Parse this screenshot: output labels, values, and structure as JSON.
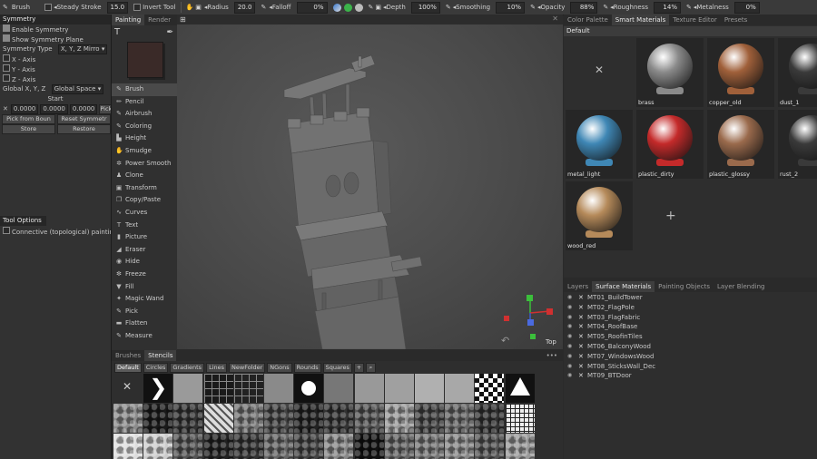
{
  "toolbar": {
    "brush_label": "Brush",
    "brush_size": "15.0",
    "steady_stroke": "Steady Stroke",
    "invert_tool": "Invert Tool",
    "radius_label": "Radius",
    "radius_value": "20.0",
    "falloff_label": "Falloff",
    "falloff_value": "0%",
    "depth_label": "Depth",
    "depth_value": "100%",
    "smoothing_label": "Smoothing",
    "smoothing_value": "10%",
    "opacity_label": "Opacity",
    "opacity_value": "88%",
    "roughness_label": "Roughness",
    "roughness_value": "14%",
    "metalness_label": "Metalness",
    "metalness_value": "0%"
  },
  "symmetry": {
    "title": "Symmetry",
    "enable": "Enable Symmetry",
    "show_plane": "Show Symmetry Plane",
    "type_label": "Symmetry Type",
    "type_value": "X, Y, Z Mirro",
    "x_axis": "X - Axis",
    "y_axis": "Y - Axis",
    "z_axis": "Z - Axis",
    "global_label": "Global X, Y, Z",
    "global_value": "Global Space",
    "start_label": "Start",
    "coord_x": "0.0000",
    "coord_y": "0.0000",
    "coord_z": "0.0000",
    "pick_btn": "Pick",
    "pick_from_bounds": "Pick from Boun",
    "reset_symmetry": "Reset Symmetr",
    "store": "Store",
    "restore": "Restore"
  },
  "tool_options": {
    "title": "Tool Options",
    "connective": "Connective (topological) paintin"
  },
  "tools_tabs": {
    "painting": "Painting",
    "render": "Render"
  },
  "tools": [
    {
      "icon": "brush-icon",
      "glyph": "✎",
      "label": "Brush"
    },
    {
      "icon": "pencil-icon",
      "glyph": "✏",
      "label": "Pencil"
    },
    {
      "icon": "airbrush-icon",
      "glyph": "✎",
      "label": "Airbrush"
    },
    {
      "icon": "coloring-icon",
      "glyph": "✎",
      "label": "Coloring"
    },
    {
      "icon": "height-icon",
      "glyph": "▙",
      "label": "Height"
    },
    {
      "icon": "smudge-icon",
      "glyph": "✋",
      "label": "Smudge"
    },
    {
      "icon": "power-smooth-icon",
      "glyph": "✲",
      "label": "Power Smooth"
    },
    {
      "icon": "clone-icon",
      "glyph": "♟",
      "label": "Clone"
    },
    {
      "icon": "transform-icon",
      "glyph": "▣",
      "label": "Transform"
    },
    {
      "icon": "copy-paste-icon",
      "glyph": "❐",
      "label": "Copy/Paste"
    },
    {
      "icon": "curves-icon",
      "glyph": "∿",
      "label": "Curves"
    },
    {
      "icon": "text-icon",
      "glyph": "T",
      "label": "Text"
    },
    {
      "icon": "picture-icon",
      "glyph": "▮",
      "label": "Picture"
    },
    {
      "icon": "eraser-icon",
      "glyph": "◢",
      "label": "Eraser"
    },
    {
      "icon": "hide-icon",
      "glyph": "◉",
      "label": "Hide"
    },
    {
      "icon": "freeze-icon",
      "glyph": "✼",
      "label": "Freeze"
    },
    {
      "icon": "fill-icon",
      "glyph": "▼",
      "label": "Fill"
    },
    {
      "icon": "magic-wand-icon",
      "glyph": "✦",
      "label": "Magic Wand"
    },
    {
      "icon": "pick-icon",
      "glyph": "✎",
      "label": "Pick"
    },
    {
      "icon": "flatten-icon",
      "glyph": "▬",
      "label": "Flatten"
    },
    {
      "icon": "measure-icon",
      "glyph": "✎",
      "label": "Measure"
    }
  ],
  "viewport": {
    "view_label": "Top"
  },
  "right_tabs": [
    "Color Palette",
    "Smart Materials",
    "Texture Editor",
    "Presets"
  ],
  "materials_folder": "Default",
  "materials": [
    {
      "name": "",
      "color": "#2e2e2e",
      "empty": true
    },
    {
      "name": "brass",
      "color": "#8a8a8a"
    },
    {
      "name": "copper_old",
      "color": "#a0603a"
    },
    {
      "name": "dust_1",
      "color": "#3a3a3a"
    },
    {
      "name": "metal_light",
      "color": "#3f87b5"
    },
    {
      "name": "plastic_dirty",
      "color": "#c42a2a"
    },
    {
      "name": "plastic_glossy",
      "color": "#9a6a4c"
    },
    {
      "name": "rust_2",
      "color": "#3a3a3a"
    },
    {
      "name": "wood_red",
      "color": "#b58a5a"
    }
  ],
  "layer_tabs": [
    "Layers",
    "Surface Materials",
    "Painting Objects",
    "Layer Blending"
  ],
  "layers": [
    "MT01_BuildTower",
    "MT02_FlagPole",
    "MT03_FlagFabric",
    "MT04_RoofBase",
    "MT05_RoofinTiles",
    "MT06_BalconyWood",
    "MT07_WindowsWood",
    "MT08_SticksWall_Dec",
    "MT09_BTDoor"
  ],
  "bottom_tabs": {
    "brushes": "Brushes",
    "stencils": "Stencils"
  },
  "stencil_filters": [
    "Default",
    "Circles",
    "Gradients",
    "Lines",
    "NewFolder",
    "NGons",
    "Rounds",
    "Squares"
  ],
  "colors": {
    "accent": "#4a90c8",
    "primary_color": "#3a2a28"
  }
}
